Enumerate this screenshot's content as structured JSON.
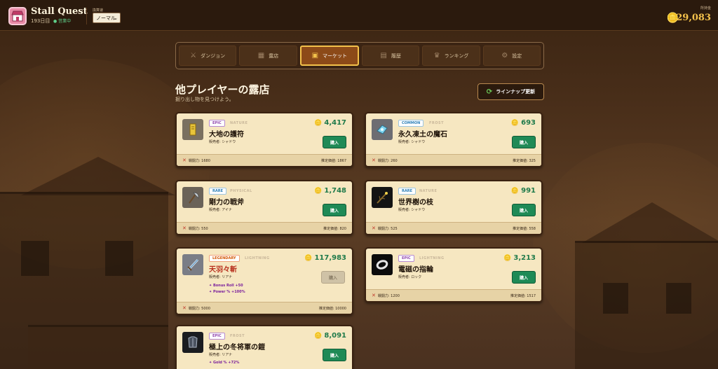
{
  "header": {
    "title": "Stall Quest",
    "day": "193日目",
    "status": "● 営業中",
    "speed_label": "換算速",
    "speed_value": "ノーマル",
    "gold_label": "所持金",
    "gold_amount": "29,083"
  },
  "nav": {
    "tabs": [
      {
        "label": "ダンジョン",
        "icon": "swords-icon",
        "active": false
      },
      {
        "label": "露店",
        "icon": "stall-icon",
        "active": false
      },
      {
        "label": "マーケット",
        "icon": "market-icon",
        "active": true
      },
      {
        "label": "履歴",
        "icon": "history-icon",
        "active": false
      },
      {
        "label": "ランキング",
        "icon": "trophy-icon",
        "active": false
      },
      {
        "label": "設定",
        "icon": "gear-icon",
        "active": false
      }
    ]
  },
  "page": {
    "title": "他プレイヤーの露店",
    "subtitle": "掘り出し物を見つけよう。",
    "refresh_label": "ラインナップ更新"
  },
  "cards": [
    {
      "rarity": "EPIC",
      "element": "NATURE",
      "name": "大地の護符",
      "seller": "販売者: シャドウ",
      "price": "4,417",
      "buy": "購入",
      "power": "戦闘力: 1680",
      "estimate": "推定価値: 1867",
      "bonuses": [],
      "buy_disabled": false
    },
    {
      "rarity": "COMMON",
      "element": "FROST",
      "name": "永久凍土の魔石",
      "seller": "販売者: シャドウ",
      "price": "693",
      "buy": "購入",
      "power": "戦闘力: 260",
      "estimate": "推定価値: 325",
      "bonuses": [],
      "buy_disabled": false
    },
    {
      "rarity": "RARE",
      "element": "PHYSICAL",
      "name": "剛力の戦斧",
      "seller": "販売者: アイナ",
      "price": "1,748",
      "buy": "購入",
      "power": "戦闘力: 550",
      "estimate": "推定価値: 820",
      "bonuses": [],
      "buy_disabled": false
    },
    {
      "rarity": "RARE",
      "element": "NATURE",
      "name": "世界樹の枝",
      "seller": "販売者: シャドウ",
      "price": "991",
      "buy": "購入",
      "power": "戦闘力: 525",
      "estimate": "推定価値: 558",
      "bonuses": [],
      "buy_disabled": false
    },
    {
      "rarity": "LEGENDARY",
      "element": "LIGHTNING",
      "name": "天羽々斬",
      "seller": "販売者: リアナ",
      "price": "117,983",
      "buy": "購入",
      "power": "戦闘力: 5000",
      "estimate": "推定価値: 10000",
      "bonuses": [
        "Bonus Roll +50",
        "Power % +100%"
      ],
      "buy_disabled": true
    },
    {
      "rarity": "EPIC",
      "element": "LIGHTNING",
      "name": "電磁の指輪",
      "seller": "販売者: ロック",
      "price": "3,213",
      "buy": "購入",
      "power": "戦闘力: 1200",
      "estimate": "推定価値: 1517",
      "bonuses": [],
      "buy_disabled": false
    },
    {
      "rarity": "EPIC",
      "element": "FROST",
      "name": "極上の冬将軍の鎧",
      "seller": "販売者: リアナ",
      "price": "8,091",
      "buy": "購入",
      "power": "",
      "estimate": "",
      "bonuses": [
        "Gold % +72%"
      ],
      "buy_disabled": false
    }
  ],
  "colors": {
    "accent_gold": "#f3c14b",
    "buy_green": "#1f8a56",
    "price_green": "#1f7a4a",
    "epic": "#8e44ad",
    "common": "#2c7fb8",
    "rare": "#2c7fb8",
    "legendary": "#d35400"
  }
}
